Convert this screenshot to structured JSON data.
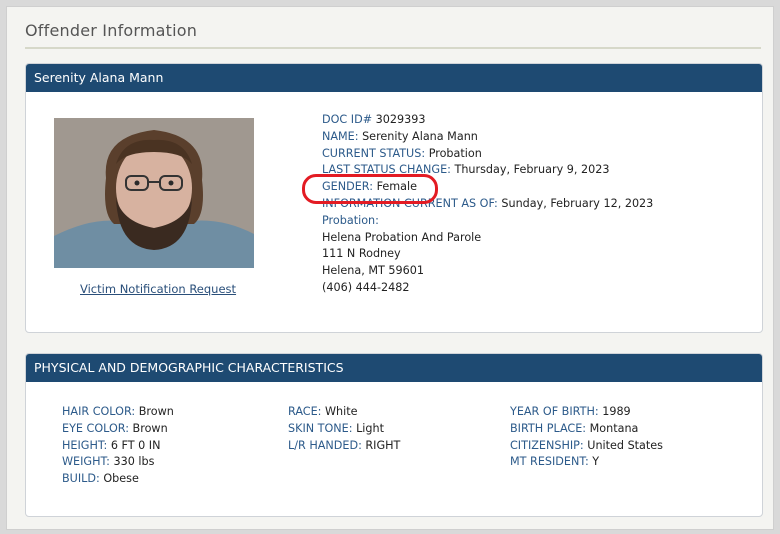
{
  "page_title": "Offender Information",
  "offender": {
    "header_name": "Serenity Alana Mann",
    "victim_link": "Victim Notification Request",
    "fields": [
      {
        "label": "DOC ID#",
        "value": "3029393"
      },
      {
        "label": "NAME:",
        "value": "Serenity Alana Mann"
      },
      {
        "label": "CURRENT STATUS:",
        "value": "Probation"
      },
      {
        "label": "LAST STATUS CHANGE:",
        "value": "Thursday, February 9, 2023"
      },
      {
        "label": "GENDER:",
        "value": "Female"
      },
      {
        "label": "INFORMATION CURRENT AS OF:",
        "value": "Sunday, February 12, 2023"
      }
    ],
    "probation_label": "Probation:",
    "address": [
      "Helena Probation And Parole",
      "111 N Rodney",
      "Helena, MT 59601",
      "(406) 444-2482"
    ]
  },
  "characteristics": {
    "header": "PHYSICAL AND DEMOGRAPHIC CHARACTERISTICS",
    "col1": [
      {
        "label": "HAIR COLOR:",
        "value": "Brown"
      },
      {
        "label": "EYE COLOR:",
        "value": "Brown"
      },
      {
        "label": "HEIGHT:",
        "value": "6 FT 0 IN"
      },
      {
        "label": "WEIGHT:",
        "value": "330 lbs"
      },
      {
        "label": "BUILD:",
        "value": "Obese"
      }
    ],
    "col2": [
      {
        "label": "RACE:",
        "value": "White"
      },
      {
        "label": "SKIN TONE:",
        "value": "Light"
      },
      {
        "label": "L/R HANDED:",
        "value": "RIGHT"
      }
    ],
    "col3": [
      {
        "label": "YEAR OF BIRTH:",
        "value": "1989"
      },
      {
        "label": "BIRTH PLACE:",
        "value": "Montana"
      },
      {
        "label": "CITIZENSHIP:",
        "value": "United States"
      },
      {
        "label": "MT RESIDENT:",
        "value": "Y"
      }
    ]
  },
  "colors": {
    "header_bg": "#1e4a72",
    "label": "#2c5a8a",
    "highlight": "#e31b23"
  }
}
